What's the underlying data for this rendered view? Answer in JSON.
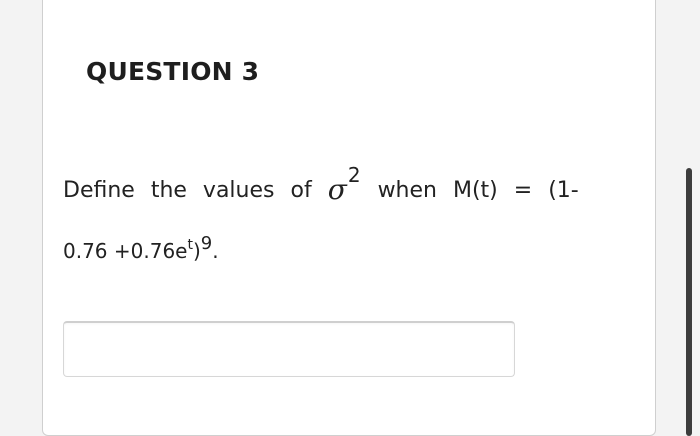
{
  "question": {
    "title": "QUESTION 3",
    "line1_words": [
      "Define",
      "the",
      "values",
      "of"
    ],
    "sigma": "σ",
    "sigma_exponent": "2",
    "line1_rest": [
      "when",
      "M(t)",
      "=",
      "(1-"
    ],
    "line2_prefix": "0.76 +0.76e",
    "line2_sup_t": "t",
    "line2_paren": ")",
    "line2_sup_9": "9",
    "line2_end": "."
  },
  "answer": {
    "value": "",
    "placeholder": ""
  }
}
